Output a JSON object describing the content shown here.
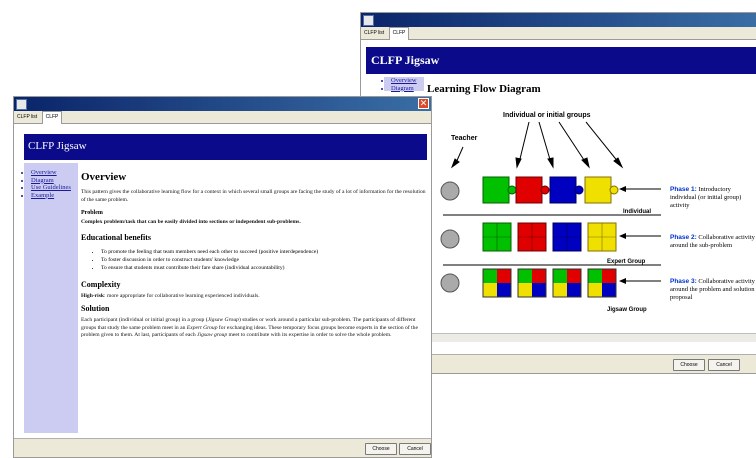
{
  "back_window": {
    "tabs": [
      "CLFP list",
      "CLFP"
    ],
    "banner_title": "CLFP Jigsaw",
    "sidebar": [
      "Overview",
      "Diagram"
    ],
    "diagram_title": "Learning Flow Diagram",
    "labels": {
      "teacher": "Teacher",
      "groups": "Individual or initial groups",
      "individual": "Individual",
      "expert": "Expert Group",
      "jigsaw": "Jigsaw Group"
    },
    "phases": [
      {
        "label": "Phase 1:",
        "text": "Introductory individual (or initial group) activity"
      },
      {
        "label": "Phase 2:",
        "text": "Collaborative activity around the sub-problem"
      },
      {
        "label": "Phase 3:",
        "text": "Collaborative activity around the problem and solution proposal"
      }
    ],
    "buttons": {
      "choose": "Choose",
      "cancel": "Cancel"
    },
    "colors": {
      "green": "#00c000",
      "red": "#e00000",
      "blue": "#0000c0",
      "yellow": "#f0e000",
      "phase": "#0033cc"
    }
  },
  "front_window": {
    "tabs": [
      "CLFP list",
      "CLFP"
    ],
    "banner_title": "CLFP Jigsaw",
    "sidebar": [
      "Overview",
      "Diagram",
      "Use Guidelines",
      "Example"
    ],
    "heading": "Overview",
    "intro": "This pattern gives the collaborative learning flow for a context in which several small groups are facing the study of a lot of information for the resolution of the same problem.",
    "problem_heading": "Problem",
    "problem_text": "Complex problem/task that can be easily divided into sections or independent sub-problems.",
    "benefits_heading": "Educational benefits",
    "benefits": [
      "To promote the feeling that team members need each other to succeed (positive interdependence)",
      "To foster discussion in order to construct students' knowledge",
      "To ensure that students must contribute their fare share (individual accountability)"
    ],
    "complexity_heading": "Complexity",
    "complexity_label": "High-risk",
    "complexity_text": ": more appropriate for collaborative learning experienced individuals.",
    "solution_heading": "Solution",
    "solution_text": [
      "Each participant (individual or initial group) in a group (",
      "Jigsaw Group",
      ") studies or work around a particular sub-problem. The participants of different groups that study the same problem meet in an ",
      "Expert Group",
      " for exchanging ideas. These temporary focus groups become experts in the section of the problem given to them. At last, participants of each ",
      "Jigsaw group",
      " meet to contribute with its expertise in order to solve the whole problem."
    ],
    "buttons": {
      "choose": "Choose",
      "cancel": "Cancel"
    }
  }
}
